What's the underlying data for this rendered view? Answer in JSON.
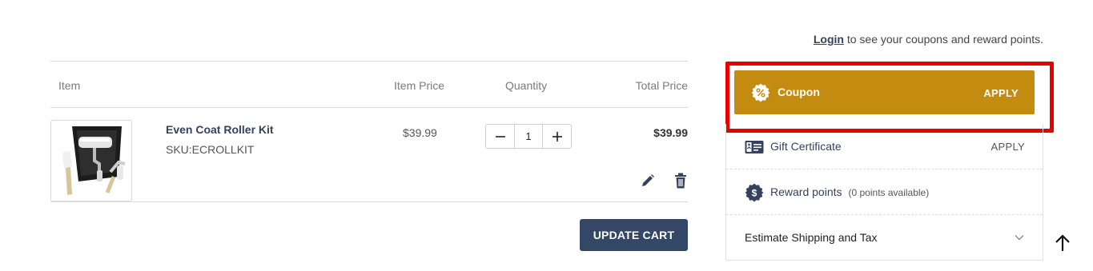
{
  "login_prompt": {
    "link_label": "Login",
    "text": " to see your coupons and reward points."
  },
  "cart": {
    "headers": {
      "item": "Item",
      "item_price": "Item Price",
      "quantity": "Quantity",
      "total_price": "Total Price"
    },
    "items": [
      {
        "name": "Even Coat Roller Kit",
        "sku": "SKU:ECROLLKIT",
        "price": "$39.99",
        "quantity": "1",
        "total": "$39.99",
        "image_icon": "paint-roller-kit-image"
      }
    ],
    "update_label": "UPDATE CART"
  },
  "sidebar": {
    "coupon": {
      "label": "Coupon",
      "action": "APPLY",
      "icon": "percent-badge-icon",
      "color": "#c48b11"
    },
    "gift_certificate": {
      "label": "Gift Certificate",
      "action": "APPLY",
      "icon": "gift-card-icon"
    },
    "reward_points": {
      "label": "Reward points",
      "note": "(0 points available)",
      "icon": "dollar-badge-icon"
    },
    "shipping": {
      "label": "Estimate Shipping and Tax",
      "icon": "chevron-down-icon"
    }
  },
  "colors": {
    "primary_navy": "#344766",
    "coupon_gold": "#c48b11",
    "highlight_red": "#e60000"
  }
}
